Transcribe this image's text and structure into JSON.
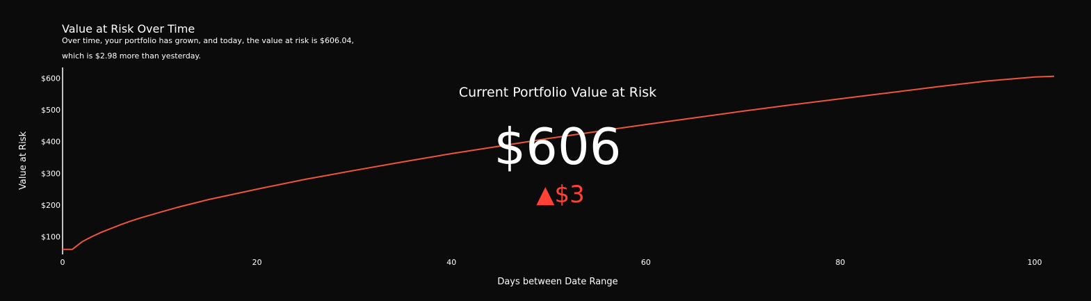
{
  "colors": {
    "background": "#0b0b0b",
    "line": "#ef553b",
    "text": "#ffffff",
    "delta": "#ff4136"
  },
  "chart_data": {
    "type": "line",
    "title": "Value at Risk Over Time",
    "subtitle_lines": [
      "Over time, your portfolio has grown, and today, the value at risk is $606.04,",
      "which is $2.98 more than yesterday."
    ],
    "xlabel": "Days between Date Range",
    "ylabel": "Value at Risk",
    "xlim": [
      0,
      103
    ],
    "ylim": [
      44,
      634
    ],
    "x_ticks": [
      0,
      20,
      40,
      60,
      80,
      100
    ],
    "y_ticks": [
      100,
      200,
      300,
      400,
      500,
      600
    ],
    "y_tick_labels": [
      "$100",
      "$200",
      "$300",
      "$400",
      "$500",
      "$600"
    ],
    "grid": false,
    "series": [
      {
        "x": [
          0,
          1,
          2,
          3,
          4,
          5,
          6,
          7,
          8,
          10,
          12,
          15,
          20,
          25,
          30,
          35,
          40,
          45,
          50,
          55,
          60,
          65,
          70,
          75,
          80,
          85,
          90,
          95,
          100,
          102
        ],
        "y": [
          60,
          60,
          84,
          100,
          114,
          126,
          138,
          149,
          159,
          177,
          194,
          217,
          250,
          281,
          309,
          336,
          362,
          386,
          410,
          432,
          454,
          475,
          496,
          516,
          535,
          554,
          573,
          591,
          604,
          606
        ]
      }
    ],
    "indicator": {
      "title": "Current Portfolio Value at Risk",
      "value": "$606",
      "delta_symbol": "▲",
      "delta": "$3"
    }
  }
}
